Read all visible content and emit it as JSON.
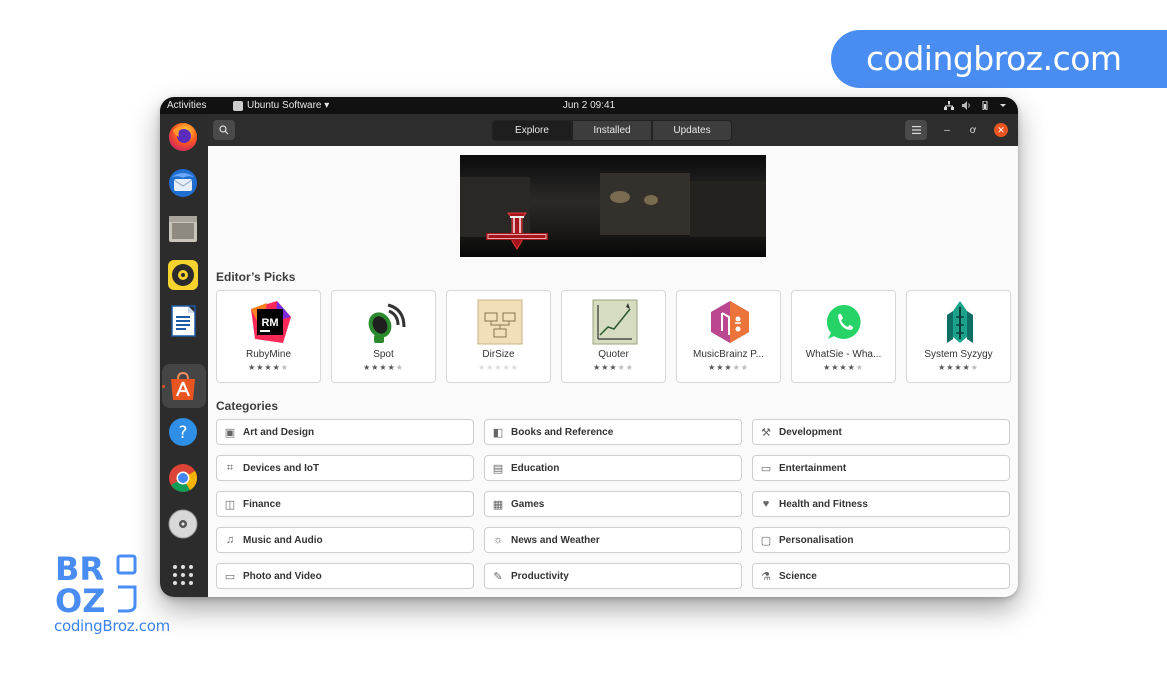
{
  "brand": {
    "pill_text": "codingbroz.com",
    "logo_text_line1": "BR",
    "logo_text_line2": "OZ",
    "url_text": "codingBroz.com",
    "accent": "#4a8df2"
  },
  "topbar": {
    "activities": "Activities",
    "app_menu": "Ubuntu Software ▾",
    "clock": "Jun 2  09:41",
    "tray_icons": [
      "network-icon",
      "volume-icon",
      "battery-icon",
      "chevron-down-icon"
    ]
  },
  "dock": {
    "apps": [
      "firefox-icon",
      "thunderbird-icon",
      "files-icon",
      "rhythmbox-icon",
      "writer-icon",
      "software-icon",
      "help-icon",
      "chrome-icon",
      "disc-icon"
    ],
    "show_apps": "grid-icon",
    "active": "software-icon"
  },
  "headerbar": {
    "tabs": [
      {
        "label": "Explore",
        "active": true
      },
      {
        "label": "Installed",
        "active": false
      },
      {
        "label": "Updates",
        "active": false
      }
    ]
  },
  "content": {
    "editors_picks_title": "Editor’s Picks",
    "picks": [
      {
        "name": "RubyMine",
        "stars": "★★★★★",
        "rating": 4
      },
      {
        "name": "Spot",
        "stars": "★★★★★",
        "rating": 4
      },
      {
        "name": "DirSize",
        "stars": "★★★★★",
        "rating": 0
      },
      {
        "name": "Quoter",
        "stars": "★★★★★",
        "rating": 3
      },
      {
        "name": "MusicBrainz P...",
        "stars": "★★★★★",
        "rating": 3
      },
      {
        "name": "WhatSie - Wha...",
        "stars": "★★★★★",
        "rating": 4
      },
      {
        "name": "System Syzygy",
        "stars": "★★★★★",
        "rating": 4
      }
    ],
    "categories_title": "Categories",
    "categories": [
      {
        "label": "Art and Design",
        "icon": "▣"
      },
      {
        "label": "Books and Reference",
        "icon": "◧"
      },
      {
        "label": "Development",
        "icon": "⚒"
      },
      {
        "label": "Devices and IoT",
        "icon": "⌗"
      },
      {
        "label": "Education",
        "icon": "▤"
      },
      {
        "label": "Entertainment",
        "icon": "▭"
      },
      {
        "label": "Finance",
        "icon": "◫"
      },
      {
        "label": "Games",
        "icon": "▦"
      },
      {
        "label": "Health and Fitness",
        "icon": "♥"
      },
      {
        "label": "Music and Audio",
        "icon": "♫"
      },
      {
        "label": "News and Weather",
        "icon": "☼"
      },
      {
        "label": "Personalisation",
        "icon": "▢"
      },
      {
        "label": "Photo and Video",
        "icon": "▭"
      },
      {
        "label": "Productivity",
        "icon": "✎"
      },
      {
        "label": "Science",
        "icon": "⚗"
      }
    ]
  }
}
